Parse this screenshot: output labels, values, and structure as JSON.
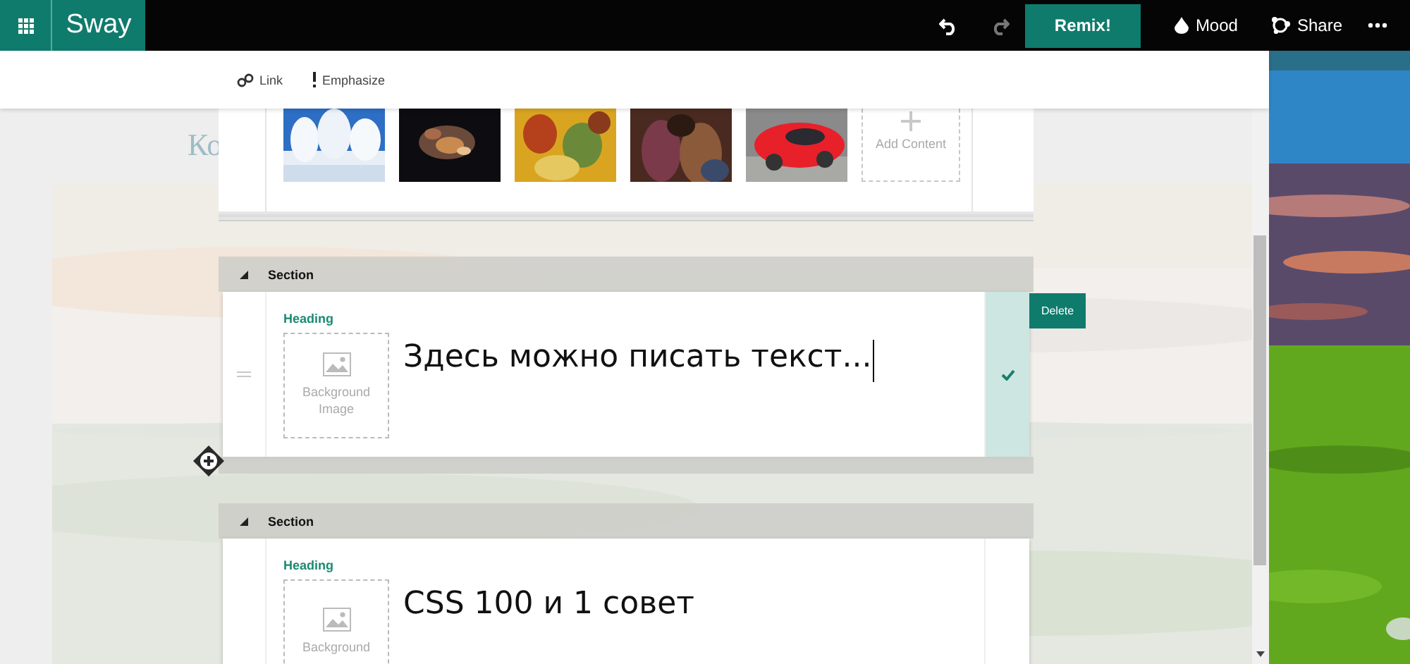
{
  "app_bar": {
    "app_name": "Sway",
    "history": [
      {
        "kind": "undo",
        "disabled": false
      },
      {
        "kind": "redo",
        "disabled": true
      }
    ],
    "remix_label": "Remix!",
    "mood_label": "Mood",
    "share_label": "Share"
  },
  "format_bar": [
    {
      "kind": "link",
      "label": "Link"
    },
    {
      "kind": "emphasize",
      "label": "Emphasize"
    }
  ],
  "background_title_fragment": "Ко",
  "gallery": {
    "add_label": "Add Content"
  },
  "sections": [
    {
      "title": "Section",
      "heading_label": "Heading",
      "background_label": "Background Image",
      "text": "Здесь можно писать текст...",
      "selected": true,
      "delete_label": "Delete"
    },
    {
      "title": "Section",
      "heading_label": "Heading",
      "background_label": "Background",
      "text": "CSS 100 и 1 совет",
      "selected": false
    }
  ]
}
